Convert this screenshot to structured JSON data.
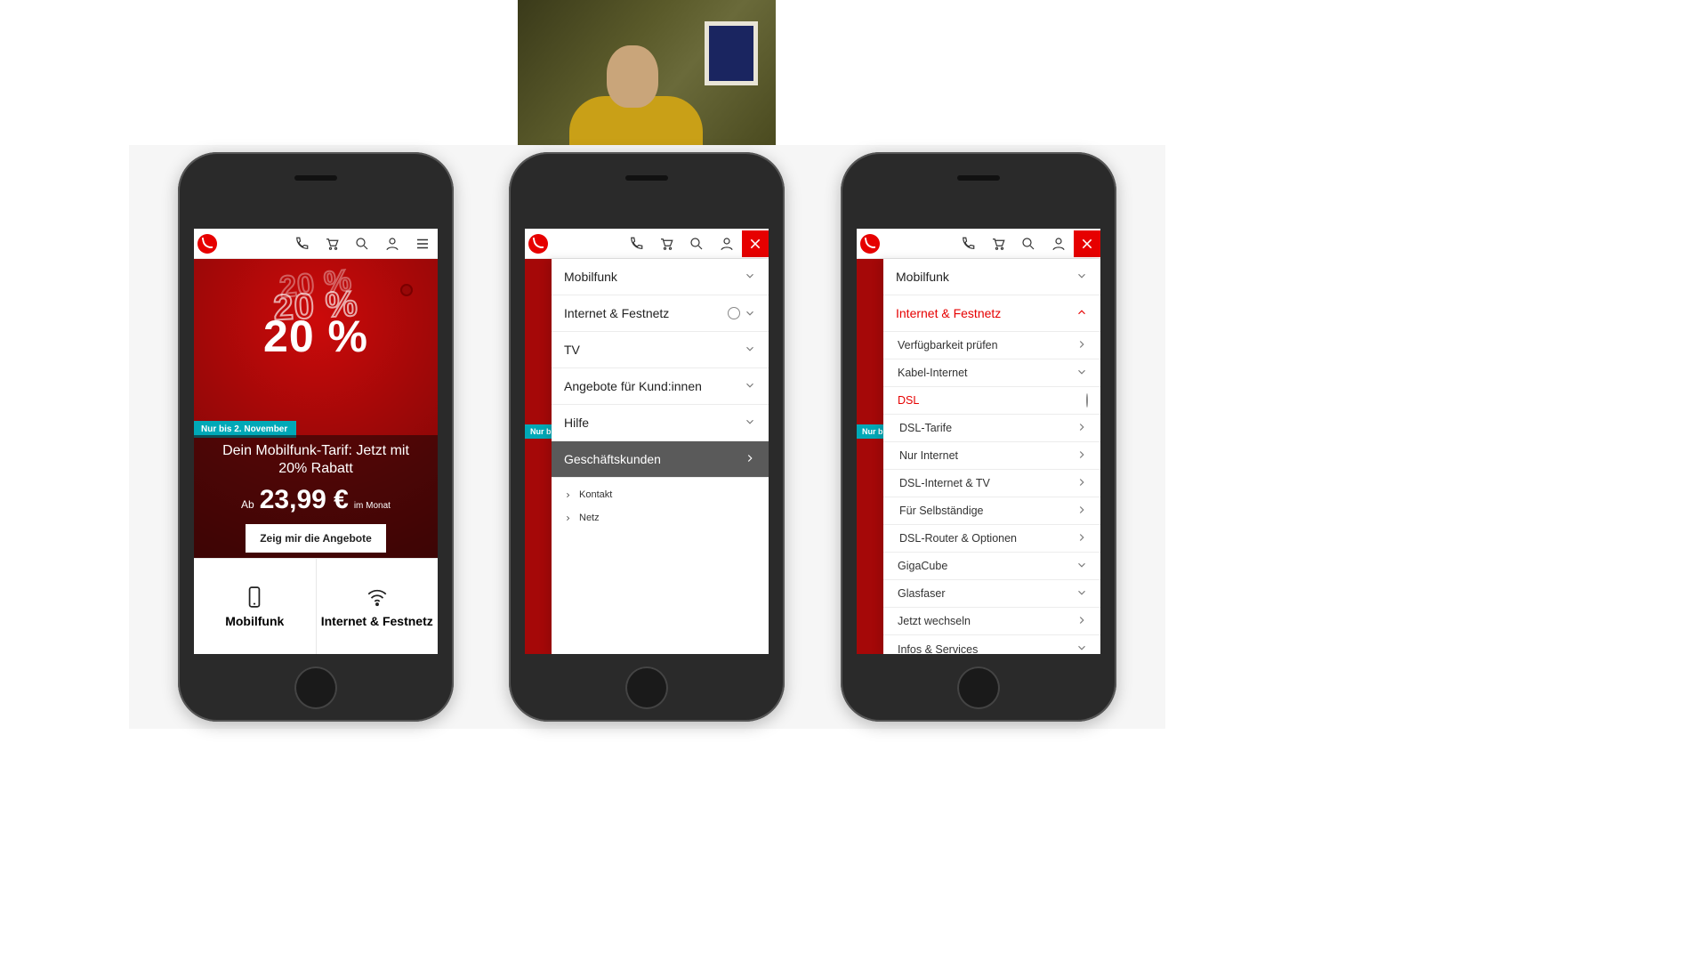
{
  "brand": {
    "accent": "#e60000",
    "teal": "#00a9b7"
  },
  "header_icons": [
    "phone-icon",
    "cart-icon",
    "search-icon",
    "user-icon"
  ],
  "phone1": {
    "percent": "20 %",
    "badge": "Nur bis 2. November",
    "title": "Dein Mobilfunk-Tarif: Jetzt mit 20% Rabatt",
    "price_prefix": "Ab",
    "price": "23,99 €",
    "price_suffix": "im Monat",
    "cta": "Zeig mir die Angebote",
    "tiles": {
      "mobile": "Mobilfunk",
      "internet": "Internet & Festnetz"
    }
  },
  "phone2": {
    "bg_badge": "Nur bi",
    "items": {
      "mobilfunk": "Mobilfunk",
      "internet": "Internet & Festnetz",
      "tv": "TV",
      "angebote": "Angebote für Kund:innen",
      "hilfe": "Hilfe",
      "business": "Geschäftskunden"
    },
    "secondary": {
      "kontakt": "Kontakt",
      "netz": "Netz"
    }
  },
  "phone3": {
    "bg_badge": "Nur b",
    "items": {
      "mobilfunk": "Mobilfunk",
      "internet": "Internet & Festnetz",
      "verf": "Verfügbarkeit prüfen",
      "kabel": "Kabel-Internet",
      "dsl": "DSL",
      "dsl_tarife": "DSL-Tarife",
      "nur_internet": "Nur Internet",
      "dsl_tv": "DSL-Internet & TV",
      "selbst": "Für Selbständige",
      "router": "DSL-Router & Optionen",
      "gigacube": "GigaCube",
      "glasfaser": "Glasfaser",
      "wechseln": "Jetzt wechseln",
      "infos": "Infos & Services"
    }
  }
}
